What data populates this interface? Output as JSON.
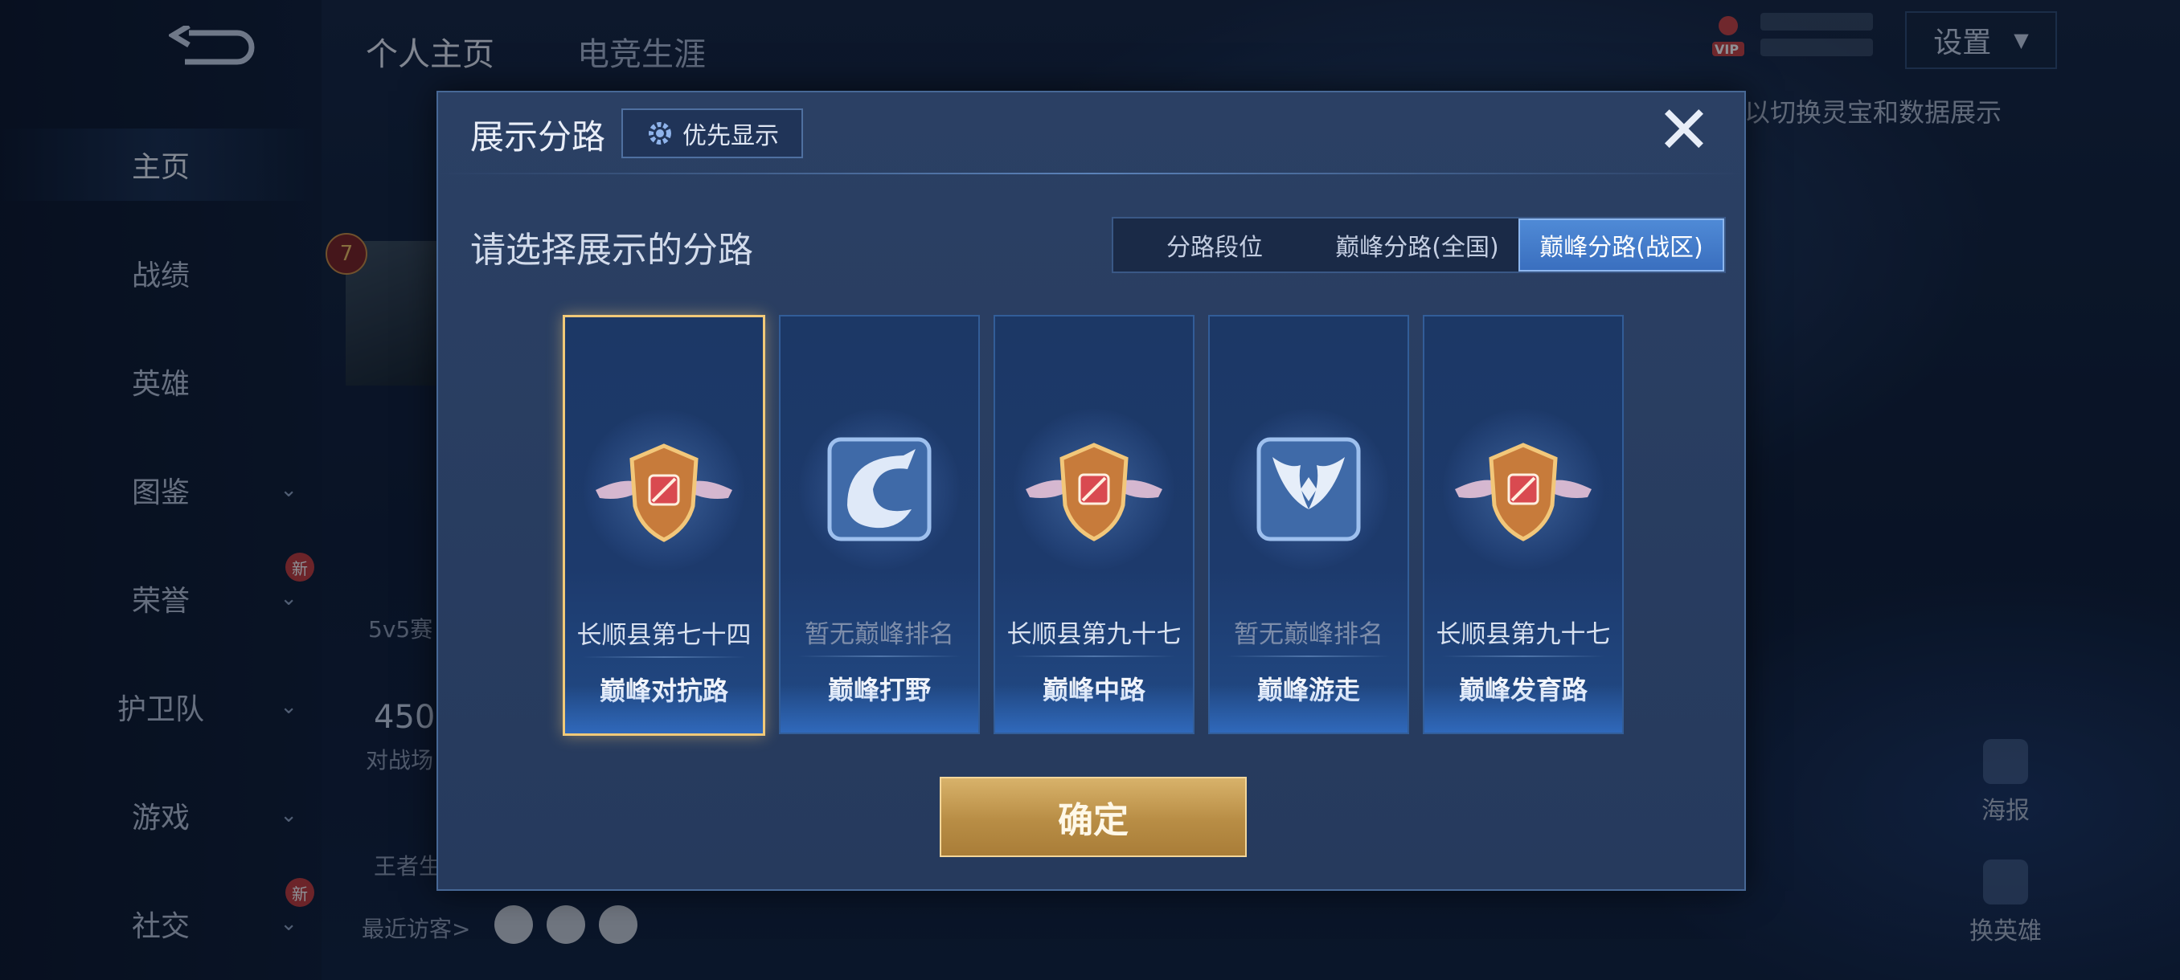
{
  "nav": {
    "items": [
      {
        "label": "主页",
        "chevron": false,
        "new": false
      },
      {
        "label": "战绩",
        "chevron": false,
        "new": false
      },
      {
        "label": "英雄",
        "chevron": false,
        "new": false
      },
      {
        "label": "图鉴",
        "chevron": true,
        "new": false
      },
      {
        "label": "荣誉",
        "chevron": true,
        "new": true
      },
      {
        "label": "护卫队",
        "chevron": true,
        "new": false
      },
      {
        "label": "游戏",
        "chevron": true,
        "new": false
      },
      {
        "label": "社交",
        "chevron": true,
        "new": true
      }
    ],
    "new_badge": "新"
  },
  "top_tabs": [
    "个人主页",
    "电竞生涯"
  ],
  "header": {
    "vip": "VIP",
    "settings_label": "设置",
    "hint": "以切换灵宝和数据展示"
  },
  "profile": {
    "level": "7",
    "mode_text": "5v5赛",
    "score": "450",
    "score_caption": "对战场",
    "title_text": "王者生",
    "recent_visitors": "最近访客>"
  },
  "right_actions": {
    "poster": "海报",
    "change_hero": "换英雄"
  },
  "modal": {
    "title": "展示分路",
    "priority_label": "优先显示",
    "close_symbol": "✕",
    "select_label": "请选择展示的分路",
    "segments": [
      "分路段位",
      "巅峰分路(全国)",
      "巅峰分路(战区)"
    ],
    "active_segment": 2,
    "cards": [
      {
        "rank": "长顺县第七十四",
        "lane": "巅峰对抗路",
        "emblem": "winged-shield-icon",
        "ranked": true,
        "selected": true
      },
      {
        "rank": "暂无巅峰排名",
        "lane": "巅峰打野",
        "emblem": "dragon-icon",
        "ranked": false,
        "selected": false
      },
      {
        "rank": "长顺县第九十七",
        "lane": "巅峰中路",
        "emblem": "winged-shield-icon",
        "ranked": true,
        "selected": false
      },
      {
        "rank": "暂无巅峰排名",
        "lane": "巅峰游走",
        "emblem": "wings-icon",
        "ranked": false,
        "selected": false
      },
      {
        "rank": "长顺县第九十七",
        "lane": "巅峰发育路",
        "emblem": "winged-shield-icon",
        "ranked": true,
        "selected": false
      }
    ],
    "confirm_label": "确定"
  },
  "colors": {
    "accent_gold": "#f1c978",
    "active_tab": "#4f8ad6",
    "modal_bg": "#2b4064"
  }
}
